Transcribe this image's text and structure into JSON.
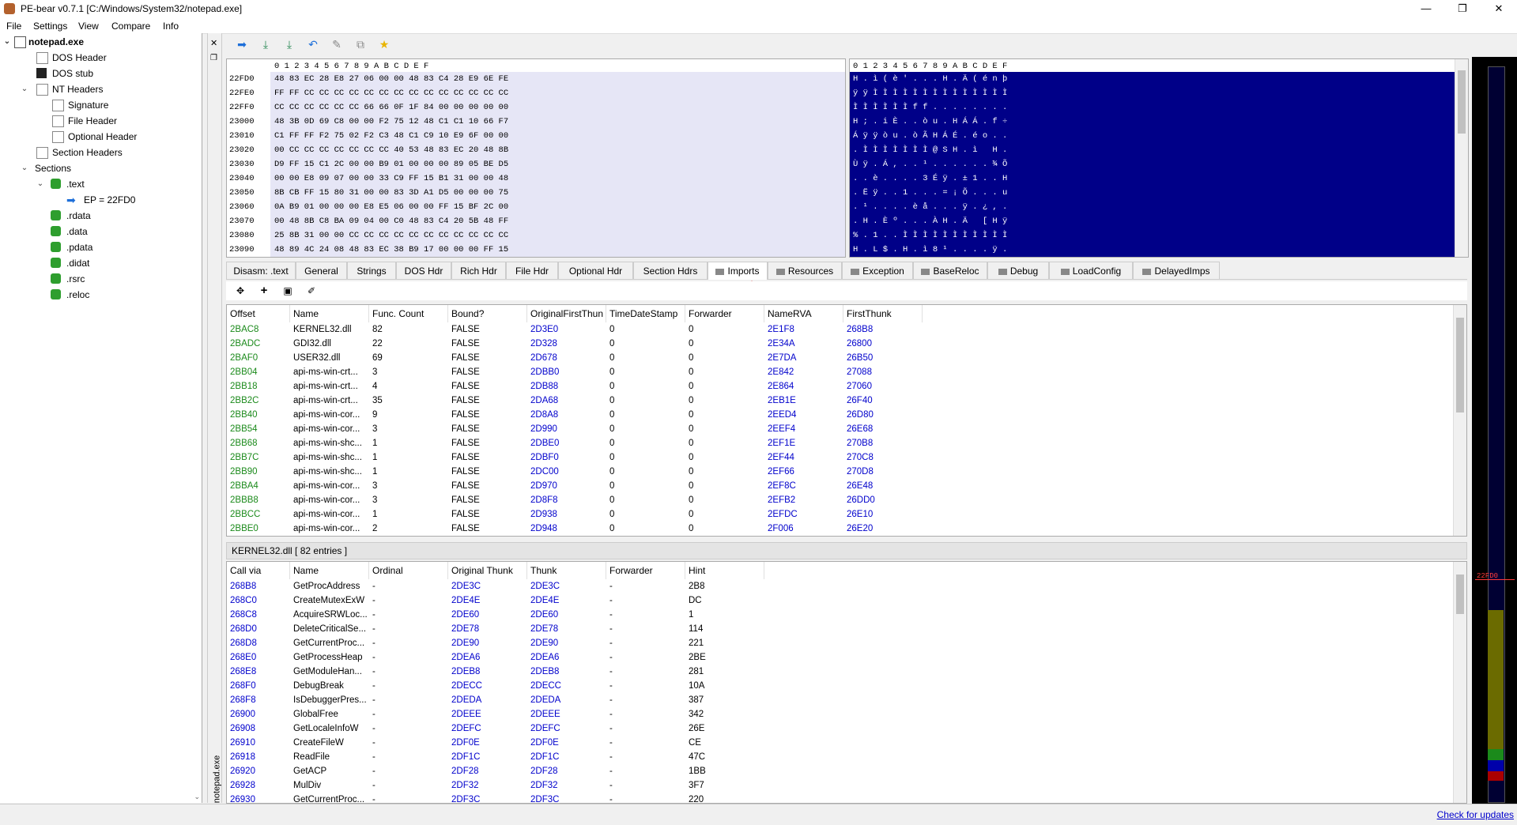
{
  "window": {
    "title": "PE-bear v0.7.1 [C:/Windows/System32/notepad.exe]",
    "minimize": "—",
    "restore": "❐",
    "close": "✕"
  },
  "menu": [
    "File",
    "Settings",
    "View",
    "Compare",
    "Info"
  ],
  "tree": {
    "root": "notepad.exe",
    "items": [
      "DOS Header",
      "DOS stub",
      "NT Headers",
      "Signature",
      "File Header",
      "Optional Header",
      "Section Headers",
      "Sections",
      ".text",
      "EP = 22FD0",
      ".rdata",
      ".data",
      ".pdata",
      ".didat",
      ".rsrc",
      ".reloc"
    ]
  },
  "side_label": "notepad.exe",
  "hex": {
    "header": "0 1 2 3 4 5 6 7 8 9 A B C D E F",
    "ascii_header": "0 1 2 3 4 5 6 7 8 9 A B C D E F",
    "rows": [
      {
        "off": "22FD0",
        "bytes": "48 83 EC 28 E8 27 06 00 00 48 83 C4 28 E9 6E FE",
        "ascii": "H . ì ( è ' . . . H . Ä ( é n þ"
      },
      {
        "off": "22FE0",
        "bytes": "FF FF CC CC CC CC CC CC CC CC CC CC CC CC CC CC",
        "ascii": "ÿ ÿ Ì Ì Ì Ì Ì Ì Ì Ì Ì Ì Ì Ì Ì Ì"
      },
      {
        "off": "22FF0",
        "bytes": "CC CC CC CC CC CC 66 66 0F 1F 84 00 00 00 00 00",
        "ascii": "Ì Ì Ì Ì Ì Ì f f . . . . . . . ."
      },
      {
        "off": "23000",
        "bytes": "48 3B 0D 69 C8 00 00 F2 75 12 48 C1 C1 10 66 F7",
        "ascii": "H ; . i È . . ò u . H Á Á . f ÷"
      },
      {
        "off": "23010",
        "bytes": "C1 FF FF F2 75 02 F2 C3 48 C1 C9 10 E9 6F 00 00",
        "ascii": "Á ÿ ÿ ò u . ò Ã H Á É . é o . ."
      },
      {
        "off": "23020",
        "bytes": "00 CC CC CC CC CC CC CC 40 53 48 83 EC 20 48 8B",
        "ascii": ". Ì Ì Ì Ì Ì Ì Ì @ S H . ì   H ."
      },
      {
        "off": "23030",
        "bytes": "D9 FF 15 C1 2C 00 00 B9 01 00 00 00 89 05 BE D5",
        "ascii": "Ù ÿ . Á , . . ¹ . . . . . . ¾ Õ"
      },
      {
        "off": "23040",
        "bytes": "00 00 E8 09 07 00 00 33 C9 FF 15 B1 31 00 00 48",
        "ascii": ". . è . . . . 3 É ÿ . ± 1 . . H"
      },
      {
        "off": "23050",
        "bytes": "8B CB FF 15 80 31 00 00 83 3D A1 D5 00 00 00 75",
        "ascii": ". Ë ÿ . . 1 . . . = ¡ Õ . . . u"
      },
      {
        "off": "23060",
        "bytes": "0A B9 01 00 00 00 E8 E5 06 00 00 FF 15 BF 2C 00",
        "ascii": ". ¹ . . . . è å . . . ÿ . ¿ , ."
      },
      {
        "off": "23070",
        "bytes": "00 48 8B C8 BA 09 04 00 C0 48 83 C4 20 5B 48 FF",
        "ascii": ". H . È º . . . À H . Ä   [ H ÿ"
      },
      {
        "off": "23080",
        "bytes": "25 8B 31 00 00 CC CC CC CC CC CC CC CC CC CC CC",
        "ascii": "% . 1 . . Ì Ì Ì Ì Ì Ì Ì Ì Ì Ì Ì"
      },
      {
        "off": "23090",
        "bytes": "48 89 4C 24 08 48 83 EC 38 B9 17 00 00 00 FF 15",
        "ascii": "H . L $ . H . ì 8 ¹ . . . . ÿ ."
      }
    ]
  },
  "tabs": [
    "Disasm: .text",
    "General",
    "Strings",
    "DOS Hdr",
    "Rich Hdr",
    "File Hdr",
    "Optional Hdr",
    "Section Hdrs",
    "Imports",
    "Resources",
    "Exception",
    "BaseReloc",
    "Debug",
    "LoadConfig",
    "DelayedImps"
  ],
  "active_tab": "Imports",
  "imports": {
    "columns": [
      "Offset",
      "Name",
      "Func. Count",
      "Bound?",
      "OriginalFirstThun",
      "TimeDateStamp",
      "Forwarder",
      "NameRVA",
      "FirstThunk"
    ],
    "rows": [
      [
        "2BAC8",
        "KERNEL32.dll",
        "82",
        "FALSE",
        "2D3E0",
        "0",
        "0",
        "2E1F8",
        "268B8"
      ],
      [
        "2BADC",
        "GDI32.dll",
        "22",
        "FALSE",
        "2D328",
        "0",
        "0",
        "2E34A",
        "26800"
      ],
      [
        "2BAF0",
        "USER32.dll",
        "69",
        "FALSE",
        "2D678",
        "0",
        "0",
        "2E7DA",
        "26B50"
      ],
      [
        "2BB04",
        "api-ms-win-crt...",
        "3",
        "FALSE",
        "2DBB0",
        "0",
        "0",
        "2E842",
        "27088"
      ],
      [
        "2BB18",
        "api-ms-win-crt...",
        "4",
        "FALSE",
        "2DB88",
        "0",
        "0",
        "2E864",
        "27060"
      ],
      [
        "2BB2C",
        "api-ms-win-crt...",
        "35",
        "FALSE",
        "2DA68",
        "0",
        "0",
        "2EB1E",
        "26F40"
      ],
      [
        "2BB40",
        "api-ms-win-cor...",
        "9",
        "FALSE",
        "2D8A8",
        "0",
        "0",
        "2EED4",
        "26D80"
      ],
      [
        "2BB54",
        "api-ms-win-cor...",
        "3",
        "FALSE",
        "2D990",
        "0",
        "0",
        "2EEF4",
        "26E68"
      ],
      [
        "2BB68",
        "api-ms-win-shc...",
        "1",
        "FALSE",
        "2DBE0",
        "0",
        "0",
        "2EF1E",
        "270B8"
      ],
      [
        "2BB7C",
        "api-ms-win-shc...",
        "1",
        "FALSE",
        "2DBF0",
        "0",
        "0",
        "2EF44",
        "270C8"
      ],
      [
        "2BB90",
        "api-ms-win-shc...",
        "1",
        "FALSE",
        "2DC00",
        "0",
        "0",
        "2EF66",
        "270D8"
      ],
      [
        "2BBA4",
        "api-ms-win-cor...",
        "3",
        "FALSE",
        "2D970",
        "0",
        "0",
        "2EF8C",
        "26E48"
      ],
      [
        "2BBB8",
        "api-ms-win-cor...",
        "3",
        "FALSE",
        "2D8F8",
        "0",
        "0",
        "2EFB2",
        "26DD0"
      ],
      [
        "2BBCC",
        "api-ms-win-cor...",
        "1",
        "FALSE",
        "2D938",
        "0",
        "0",
        "2EFDC",
        "26E10"
      ],
      [
        "2BBE0",
        "api-ms-win-cor...",
        "2",
        "FALSE",
        "2D948",
        "0",
        "0",
        "2F006",
        "26E20"
      ]
    ]
  },
  "funcs": {
    "label": "KERNEL32.dll   [ 82 entries ]",
    "columns": [
      "Call via",
      "Name",
      "Ordinal",
      "Original Thunk",
      "Thunk",
      "Forwarder",
      "Hint"
    ],
    "rows": [
      [
        "268B8",
        "GetProcAddress",
        "-",
        "2DE3C",
        "2DE3C",
        "-",
        "2B8"
      ],
      [
        "268C0",
        "CreateMutexExW",
        "-",
        "2DE4E",
        "2DE4E",
        "-",
        "DC"
      ],
      [
        "268C8",
        "AcquireSRWLoc...",
        "-",
        "2DE60",
        "2DE60",
        "-",
        "1"
      ],
      [
        "268D0",
        "DeleteCriticalSe...",
        "-",
        "2DE78",
        "2DE78",
        "-",
        "114"
      ],
      [
        "268D8",
        "GetCurrentProc...",
        "-",
        "2DE90",
        "2DE90",
        "-",
        "221"
      ],
      [
        "268E0",
        "GetProcessHeap",
        "-",
        "2DEA6",
        "2DEA6",
        "-",
        "2BE"
      ],
      [
        "268E8",
        "GetModuleHan...",
        "-",
        "2DEB8",
        "2DEB8",
        "-",
        "281"
      ],
      [
        "268F0",
        "DebugBreak",
        "-",
        "2DECC",
        "2DECC",
        "-",
        "10A"
      ],
      [
        "268F8",
        "IsDebuggerPres...",
        "-",
        "2DEDA",
        "2DEDA",
        "-",
        "387"
      ],
      [
        "26900",
        "GlobalFree",
        "-",
        "2DEEE",
        "2DEEE",
        "-",
        "342"
      ],
      [
        "26908",
        "GetLocaleInfoW",
        "-",
        "2DEFC",
        "2DEFC",
        "-",
        "26E"
      ],
      [
        "26910",
        "CreateFileW",
        "-",
        "2DF0E",
        "2DF0E",
        "-",
        "CE"
      ],
      [
        "26918",
        "ReadFile",
        "-",
        "2DF1C",
        "2DF1C",
        "-",
        "47C"
      ],
      [
        "26920",
        "GetACP",
        "-",
        "2DF28",
        "2DF28",
        "-",
        "1BB"
      ],
      [
        "26928",
        "MulDiv",
        "-",
        "2DF32",
        "2DF32",
        "-",
        "3F7"
      ],
      [
        "26930",
        "GetCurrentProc...",
        "-",
        "2DF3C",
        "2DF3C",
        "-",
        "220"
      ]
    ]
  },
  "right_marker": "22FD0",
  "status_link": "Check for updates"
}
